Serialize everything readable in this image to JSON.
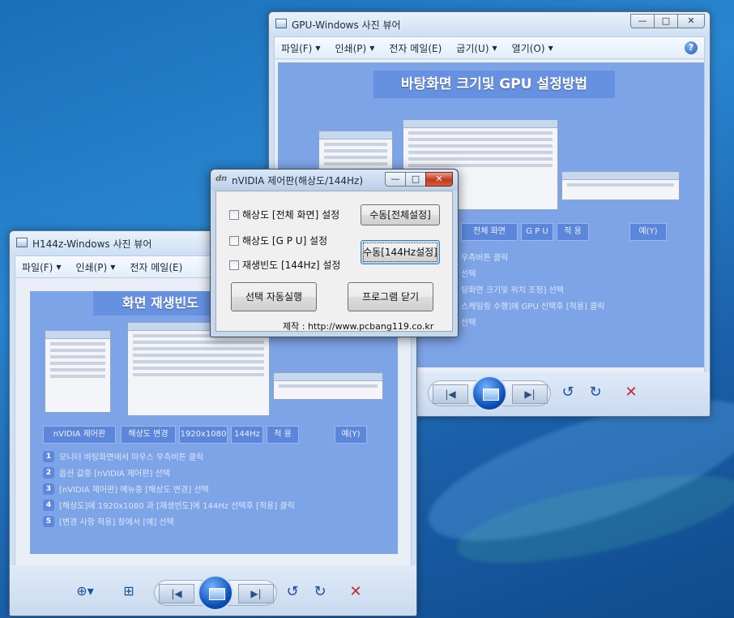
{
  "desktop": {
    "background_color": "#1b6fb8"
  },
  "gpu_window": {
    "title": "GPU-Windows 사진 뷰어",
    "menu": [
      {
        "label": "파일(F)",
        "caret": "▼"
      },
      {
        "label": "인쇄(P)",
        "caret": "▼"
      },
      {
        "label": "전자 메일(E)",
        "caret": ""
      },
      {
        "label": "굽기(U)",
        "caret": "▼"
      },
      {
        "label": "열기(O)",
        "caret": "▼"
      }
    ],
    "help": "?",
    "slide": {
      "title": "바탕화면 크기및 GPU 설정방법",
      "tags": [
        "전체 화면",
        "G P U",
        "적 용",
        "예(Y)"
      ],
      "steps": [
        "우측버튼 클릭",
        "선택",
        "탕화면 크기및 위치 조정] 선택",
        "스케일링 수행]에 GPU 선택후 [적용] 클릭",
        "선택"
      ]
    }
  },
  "h144_window": {
    "title": "H144z-Windows 사진 뷰어",
    "menu": [
      {
        "label": "파일(F)",
        "caret": "▼"
      },
      {
        "label": "인쇄(P)",
        "caret": "▼"
      },
      {
        "label": "전자 메일(E)",
        "caret": ""
      }
    ],
    "slide": {
      "title": "화면 재생빈도 ",
      "tags": [
        "nVIDIA 제어판",
        "해상도 변경",
        "1920x1080",
        "144Hz",
        "적 용",
        "예(Y)"
      ],
      "steps": [
        {
          "num": "1",
          "text": "모니터 바탕화면에서 마우스 우측버튼 클릭"
        },
        {
          "num": "2",
          "text": "옵션 값중 [nVIDIA 제어판] 선택"
        },
        {
          "num": "3",
          "text": "[nVIDIA 제어판] 메뉴중 [해상도 변경] 선택"
        },
        {
          "num": "4",
          "text": "[해상도]에 1920x1080 과 [재생빈도]에 144Hz 선택후 [적용] 클릭"
        },
        {
          "num": "5",
          "text": "[변경 사항 적용] 창에서 [예] 선택"
        }
      ]
    }
  },
  "caption_buttons": {
    "minimize": "—",
    "maximize": "□",
    "close": "✕"
  },
  "nav": {
    "zoom": "⊕▾",
    "fit": "⊞",
    "prev": "|◀",
    "next": "▶|",
    "rotate_ccw": "↺",
    "rotate_cw": "↻",
    "delete": "✕"
  },
  "dialog": {
    "logo": "dn",
    "title": "nVIDIA 제어판(해상도/144Hz)",
    "checkboxes": [
      "해상도 [전체 화면] 설정",
      "해상도 [G P U] 설정",
      "재생빈도 [144Hz] 설정"
    ],
    "buttons": {
      "manual_full": "수동[전체설정]",
      "manual_144": "수동[144Hz설정]",
      "auto_run": "선택 자동실행",
      "close_program": "프로그램 닫기"
    },
    "credit": "제작 : http://www.pcbang119.co.kr"
  }
}
